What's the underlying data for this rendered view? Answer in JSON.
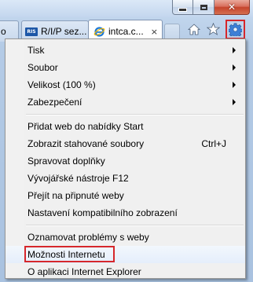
{
  "tabs": [
    {
      "label": "o"
    },
    {
      "label": "R/I/P sez..."
    },
    {
      "label": "intca.c..."
    }
  ],
  "tab_close_glyph": "×",
  "ris_favicon_text": "RIS",
  "window_controls": {
    "close_glyph": "✕"
  },
  "toolbar": {
    "home": "home-icon",
    "favorites": "star-icon",
    "tools": "gear-icon"
  },
  "menu": {
    "items": [
      {
        "label": "Tisk",
        "submenu": true
      },
      {
        "label": "Soubor",
        "submenu": true
      },
      {
        "label": "Velikost (100 %)",
        "submenu": true
      },
      {
        "label": "Zabezpečení",
        "submenu": true
      },
      {
        "label": "Přidat web do nabídky Start"
      },
      {
        "label": "Zobrazit stahované soubory",
        "shortcut": "Ctrl+J"
      },
      {
        "label": "Spravovat doplňky"
      },
      {
        "label": "Vývojářské nástroje F12"
      },
      {
        "label": "Přejít na připnuté weby"
      },
      {
        "label": "Nastavení kompatibilního zobrazení"
      },
      {
        "label": "Oznamovat problémy s weby"
      },
      {
        "label": "Možnosti Internetu",
        "highlighted": true
      },
      {
        "label": "O aplikaci Internet Explorer"
      }
    ]
  },
  "colors": {
    "highlight_border": "#d6272b",
    "menu_bg": "#f0f0f0"
  }
}
